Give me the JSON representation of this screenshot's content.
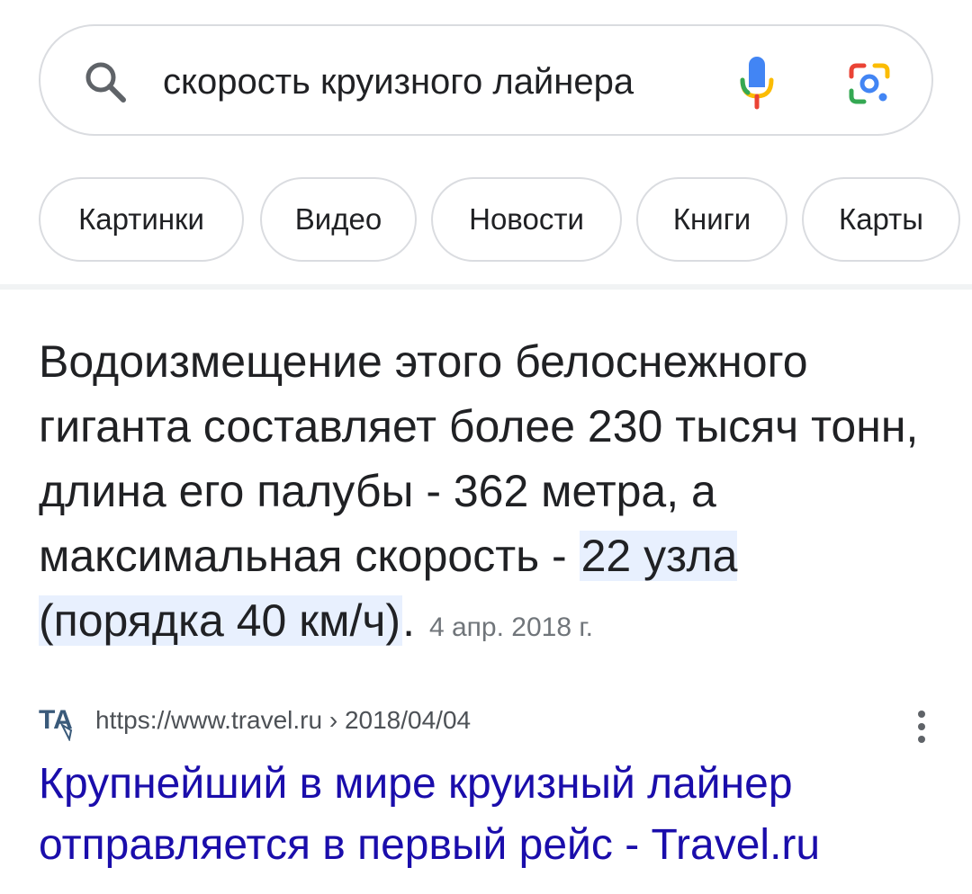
{
  "search": {
    "query": "скорость круизного лайнера",
    "icons": [
      "search-icon",
      "mic-icon",
      "lens-icon"
    ]
  },
  "chips": [
    {
      "label": "Картинки"
    },
    {
      "label": "Видео"
    },
    {
      "label": "Новости"
    },
    {
      "label": "Книги"
    },
    {
      "label": "Карты"
    }
  ],
  "snippet": {
    "text_plain": "Водоизмещение этого белоснежного гиганта составляет более 230 тысяч тонн, длина его палубы - 362 метра, а максимальная скорость - ",
    "text_highlight": "22 узла (порядка 40 км/ч)",
    "text_end": ".",
    "date": "4 апр. 2018 г."
  },
  "result": {
    "favicon_text": "TA",
    "url": "https://www.travel.ru › 2018/04/04",
    "title": "Крупнейший в мире круизный лайнер отправляется в первый рейс - Travel.ru"
  },
  "colors": {
    "link": "#1a0dab",
    "highlight": "#e8f0fe",
    "border": "#dadce0",
    "secondary_text": "#70757a"
  }
}
